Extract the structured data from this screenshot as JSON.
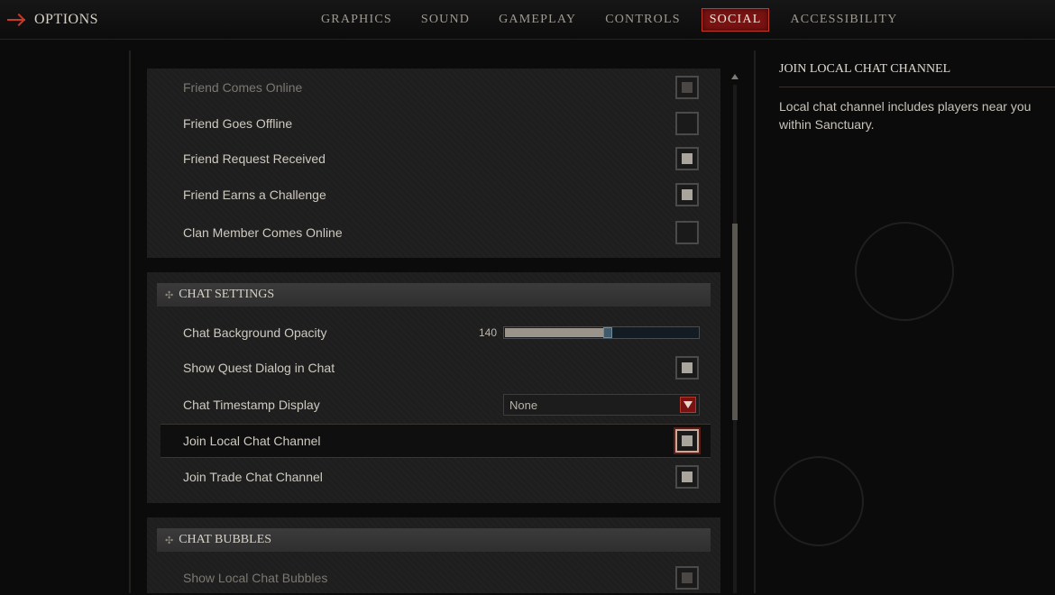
{
  "header": {
    "title": "OPTIONS",
    "tabs": [
      {
        "label": "GRAPHICS"
      },
      {
        "label": "SOUND"
      },
      {
        "label": "GAMEPLAY"
      },
      {
        "label": "CONTROLS"
      },
      {
        "label": "SOCIAL",
        "active": true
      },
      {
        "label": "ACCESSIBILITY"
      }
    ]
  },
  "notifications": {
    "items": [
      {
        "label": "Friend Comes Online",
        "checked": true,
        "dimmed": true
      },
      {
        "label": "Friend Goes Offline",
        "checked": false
      },
      {
        "label": "Friend Request Received",
        "checked": true
      },
      {
        "label": "Friend Earns a Challenge",
        "checked": true
      },
      {
        "label": "Clan Member Comes Online",
        "checked": false
      }
    ]
  },
  "chat_settings": {
    "header": "CHAT SETTINGS",
    "opacity": {
      "label": "Chat Background Opacity",
      "value": "140",
      "fraction": 0.52
    },
    "quest_dialog": {
      "label": "Show Quest Dialog in Chat",
      "checked": true
    },
    "timestamp": {
      "label": "Chat Timestamp Display",
      "value": "None"
    },
    "local_channel": {
      "label": "Join Local Chat Channel",
      "checked": true
    },
    "trade_channel": {
      "label": "Join Trade Chat Channel",
      "checked": true
    }
  },
  "chat_bubbles": {
    "header": "CHAT BUBBLES",
    "local_bubbles": {
      "label": "Show Local Chat Bubbles",
      "checked": true
    }
  },
  "info": {
    "title": "JOIN LOCAL CHAT CHANNEL",
    "text": "Local chat channel includes players near you within Sanctuary."
  },
  "colors": {
    "accent": "#7a1212",
    "accent_border": "#c0392b",
    "background": "#0b0b0b",
    "panel": "#1e1e1e"
  }
}
